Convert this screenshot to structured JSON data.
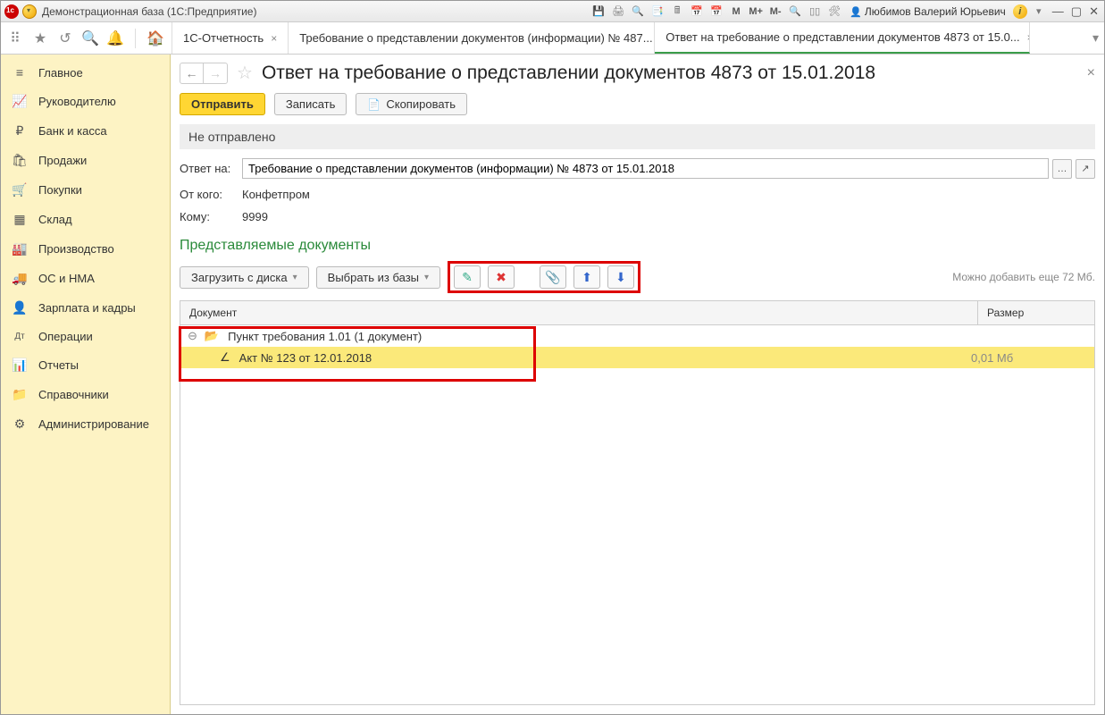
{
  "titlebar": {
    "title": "Демонстрационная база  (1С:Предприятие)",
    "user": "Любимов Валерий Юрьевич",
    "m_labels": [
      "M",
      "M+",
      "M-"
    ]
  },
  "tabs": [
    {
      "label": "1С-Отчетность"
    },
    {
      "label": "Требование о представлении документов (информации) № 487..."
    },
    {
      "label": "Ответ на требование о представлении документов 4873 от 15.0..."
    }
  ],
  "sidebar": [
    {
      "icon": "≡",
      "label": "Главное"
    },
    {
      "icon": "📈",
      "label": "Руководителю"
    },
    {
      "icon": "₽",
      "label": "Банк и касса"
    },
    {
      "icon": "🛍",
      "label": "Продажи"
    },
    {
      "icon": "🛒",
      "label": "Покупки"
    },
    {
      "icon": "▦",
      "label": "Склад"
    },
    {
      "icon": "🏭",
      "label": "Производство"
    },
    {
      "icon": "🚚",
      "label": "ОС и НМА"
    },
    {
      "icon": "👤",
      "label": "Зарплата и кадры"
    },
    {
      "icon": "Дт",
      "label": "Операции"
    },
    {
      "icon": "📊",
      "label": "Отчеты"
    },
    {
      "icon": "📁",
      "label": "Справочники"
    },
    {
      "icon": "⚙",
      "label": "Администрирование"
    }
  ],
  "page": {
    "title": "Ответ на требование о представлении документов 4873 от 15.01.2018",
    "send": "Отправить",
    "save": "Записать",
    "copy": "Скопировать",
    "status": "Не отправлено",
    "answer_lbl": "Ответ на:",
    "answer_val": "Требование о представлении документов (информации) № 4873 от 15.01.2018",
    "from_lbl": "От кого:",
    "from_val": "Конфетпром",
    "to_lbl": "Кому:",
    "to_val": "9999",
    "section": "Представляемые документы",
    "load": "Загрузить с диска",
    "pick": "Выбрать из базы",
    "hint": "Можно добавить еще 72 Мб.",
    "col_doc": "Документ",
    "col_size": "Размер",
    "group": "Пункт требования 1.01 (1 документ)",
    "leaf": "Акт № 123 от 12.01.2018",
    "leaf_size": "0,01 Мб"
  }
}
